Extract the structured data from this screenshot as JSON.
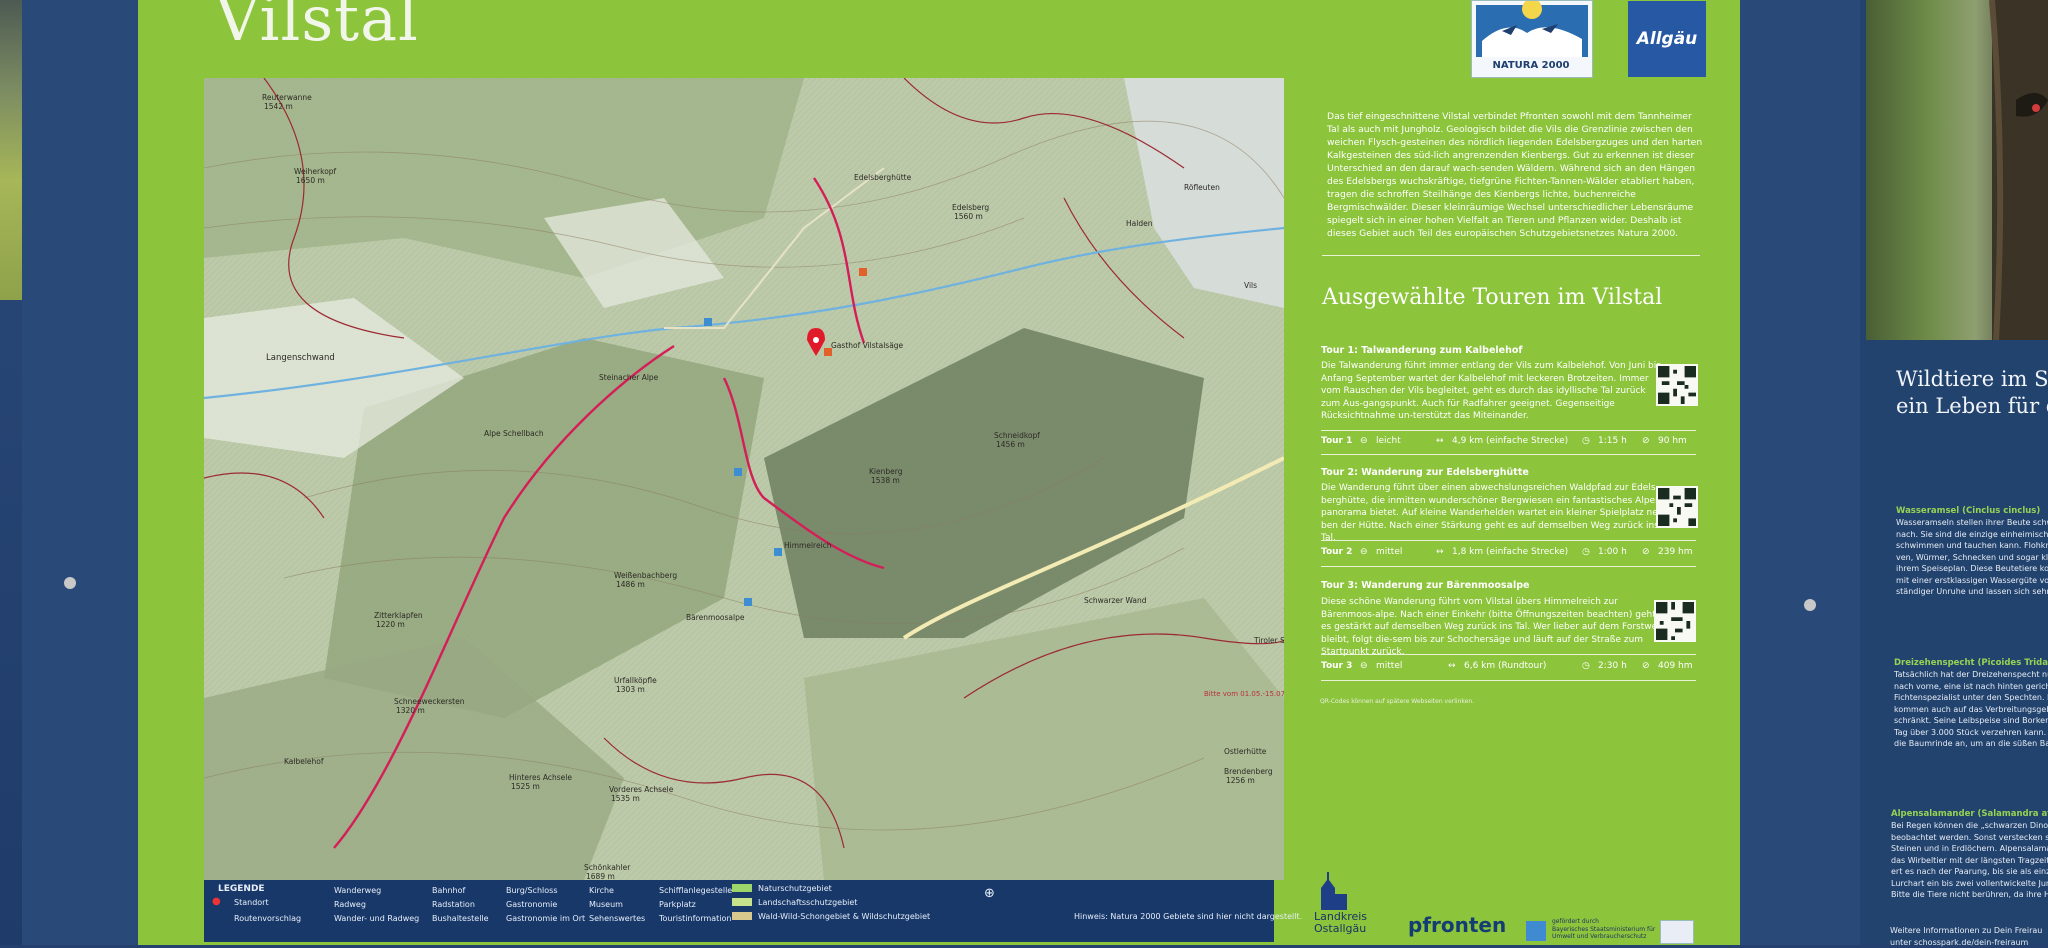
{
  "board": {
    "title": "Vilstal",
    "logos": {
      "natura": "NATURA 2000",
      "allgau": "Allgäu"
    },
    "intro": "Das tief eingeschnittene Vilstal verbindet Pfronten sowohl mit dem Tannheimer Tal als auch mit Jungholz. Geologisch bildet die Vils die Grenzlinie zwischen den weichen Flysch-gesteinen des nördlich liegenden Edelsbergzuges und den harten Kalkgesteinen des süd-lich angrenzenden Kienbergs. Gut zu erkennen ist dieser Unterschied an den darauf wach-senden Wäldern. Während sich an den Hängen des Edelsbergs wuchskräftige, tiefgrüne Fichten-Tannen-Wälder etabliert haben, tragen die schroffen Steilhänge des Kienbergs lichte, buchenreiche Bergmischwälder. Dieser kleinräumige Wechsel unterschiedlicher Lebensräume spiegelt sich in einer hohen Vielfalt an Tieren und Pflanzen wider. Deshalb ist dieses Gebiet auch Teil des europäischen Schutzgebietsnetzes Natura 2000.",
    "tours_heading": "Ausgewählte Touren im Vilstal",
    "tours": [
      {
        "title": "Tour 1:   Talwanderung zum Kalbelehof",
        "text": "Die Talwanderung führt immer entlang der Vils zum Kalbelehof. Von Juni bis Anfang September wartet der Kalbelehof mit leckeren Brotzeiten. Immer vom Rauschen der Vils begleitet, geht es durch das idyllische Tal zurück zum Aus-gangspunkt. Auch für Radfahrer geeignet. Gegenseitige Rücksichtnahme un-terstützt das Miteinander.",
        "label": "Tour 1",
        "difficulty": "leicht",
        "distance": "4,9 km (einfache Strecke)",
        "time": "1:15 h",
        "elevation": "90 hm"
      },
      {
        "title": "Tour 2:   Wanderung zur Edelsberghütte",
        "text": "Die Wanderung führt über einen abwechslungsreichen Waldpfad zur Edels-berghütte, die inmitten wunderschöner Bergwiesen ein fantastisches Alpen-panorama bietet. Auf kleine Wanderhelden wartet ein kleiner Spielplatz ne-ben der Hütte. Nach einer Stärkung geht es auf demselben Weg zurück ins Tal.",
        "label": "Tour 2",
        "difficulty": "mittel",
        "distance": "1,8 km (einfache Strecke)",
        "time": "1:00 h",
        "elevation": "239 hm"
      },
      {
        "title": "Tour 3:   Wanderung zur Bärenmoosalpe",
        "text": "Diese schöne Wanderung führt vom Vilstal übers Himmelreich zur Bärenmoos-alpe. Nach einer Einkehr (bitte Öffnungszeiten beachten) geht es gestärkt auf demselben Weg zurück ins Tal. Wer lieber auf dem Forstweg bleibt, folgt die-sem bis zur Schochersäge und läuft auf der Straße zum Startpunkt zurück.",
        "label": "Tour 3",
        "difficulty": "mittel",
        "distance": "6,6 km (Rundtour)",
        "time": "2:30 h",
        "elevation": "409 hm"
      }
    ],
    "qr_note": "QR-Codes können auf spätere Webseiten verlinken.",
    "bottom_logos": {
      "landkreis": "Landkreis\nOstallgäu",
      "pfronten": "pfronten",
      "bayern": "gefördert durch\nBayerisches Staatsministerium für\nUmwelt und Verbraucherschutz"
    }
  },
  "map": {
    "places": [
      {
        "name": "Reuterwanne",
        "sub": "1542 m"
      },
      {
        "name": "Weiherkopf",
        "sub": "1650 m"
      },
      {
        "name": "Langenschwand",
        "sub": ""
      },
      {
        "name": "Alpe Schellbach",
        "sub": ""
      },
      {
        "name": "Steinacher Alpe",
        "sub": ""
      },
      {
        "name": "Edelsberghütte",
        "sub": ""
      },
      {
        "name": "Edelsberg",
        "sub": "1560 m"
      },
      {
        "name": "Röfleuten",
        "sub": ""
      },
      {
        "name": "Halden",
        "sub": ""
      },
      {
        "name": "Vils",
        "sub": ""
      },
      {
        "name": "Gasthof Vilstalsäge",
        "sub": ""
      },
      {
        "name": "Schneidkopf",
        "sub": "1456 m"
      },
      {
        "name": "Kienberg",
        "sub": "1538 m"
      },
      {
        "name": "Himmelreich",
        "sub": ""
      },
      {
        "name": "Weißenbachberg",
        "sub": "1486 m"
      },
      {
        "name": "Bärenmoosalpe",
        "sub": ""
      },
      {
        "name": "Zitterklapfen",
        "sub": "1220 m"
      },
      {
        "name": "Schwarzer Wand",
        "sub": ""
      },
      {
        "name": "Urfallköpfle",
        "sub": "1303 m"
      },
      {
        "name": "Schneeweckersten",
        "sub": "1320 m"
      },
      {
        "name": "Kalbelehof",
        "sub": ""
      },
      {
        "name": "Hinteres Achsele",
        "sub": "1525 m"
      },
      {
        "name": "Vorderes Achsele",
        "sub": "1535 m"
      },
      {
        "name": "Schönkahler",
        "sub": "1689 m"
      },
      {
        "name": "Tiroler Stadel",
        "sub": ""
      },
      {
        "name": "Ostlerhütte",
        "sub": ""
      },
      {
        "name": "Brendenberg",
        "sub": "1256 m"
      }
    ],
    "notice": "Bitte vom 01.05.-15.07. nicht begehen!"
  },
  "legend": {
    "title": "LEGENDE",
    "items": [
      "Standort",
      "Routenvorschlag",
      "Wanderweg",
      "Radweg",
      "Wander- und Radweg",
      "Bahnhof",
      "Radstation",
      "Bushaltestelle",
      "Burg/Schloss",
      "Gastronomie",
      "Gastronomie im Ort",
      "Kirche",
      "Museum",
      "Sehenswertes",
      "Schifflanlegestelle",
      "Parkplatz",
      "Touristinformation",
      "Naturschutzgebiet",
      "Landschaftsschutzgebiet",
      "Wald-Wild-Schongebiet & Wildschutzgebiet"
    ],
    "hint": "Hinweis: Natura 2000 Gebiete sind hier nicht dargestellt."
  },
  "right_panel": {
    "heading": "Wildtiere im Sc",
    "heading2": "ein Leben für d",
    "sections": [
      {
        "title": "Wasseramsel (Cinclus cinclus)",
        "lines": [
          "Wasseramseln stellen ihrer Beute schw",
          "nach. Sie sind die einzige einheimische",
          "schwimmen und tauchen kann. Flohkre",
          "ven, Würmer, Schnecken und sogar klei",
          "ihrem Speiseplan. Diese Beutetiere kom",
          "mit einer erstklassigen Wassergüte vor.",
          "ständiger Unruhe und lassen sich sehr s"
        ]
      },
      {
        "title": "Dreizehenspecht (Picoides Tridactylus",
        "lines": [
          "Tatsächlich hat der Dreizehenspecht nu",
          "nach vorne, eine ist nach hinten gericht",
          "Fichtenspezialist unter den Spechten. D",
          "kommen auch auf das Verbreitungsgebie",
          "schränkt. Seine Leibspeise sind Borkenk",
          "Tag über 3.000 Stück verzehren kann. Im",
          "die Baumrinde an, um an die süßen Bau"
        ]
      },
      {
        "title": "Alpensalamander (Salamandra atra)",
        "lines": [
          "Bei Regen können die „schwarzen Dinos",
          "beobachtet werden. Sonst verstecken sie",
          "Steinen und in Erdlöchern. Alpensalama",
          "das Wirbeltier mit der längsten Tragzeit.",
          "ert es nach der Paarung, bis sie als einzig",
          "Lurchart ein bis zwei vollentwickelte Jung",
          "Bitte die Tiere nicht berühren, da ihre Ha"
        ]
      }
    ],
    "footer": [
      "Weitere Informationen zu Dein Freirau",
      "unter schosspark.de/dein-freiraum"
    ]
  }
}
